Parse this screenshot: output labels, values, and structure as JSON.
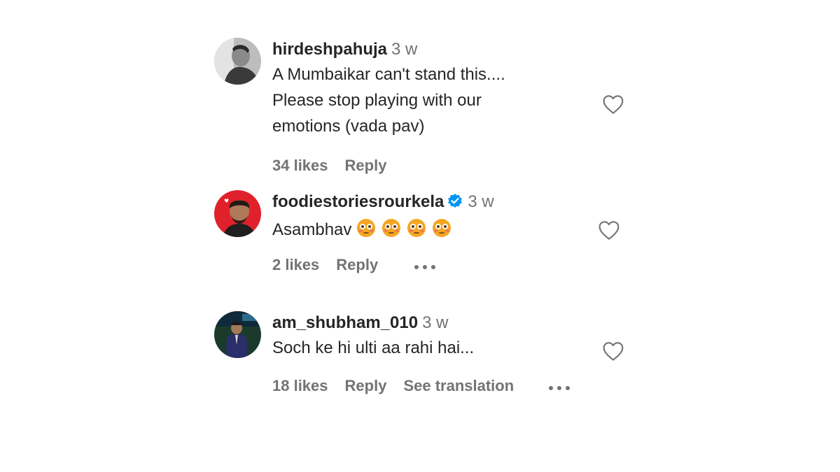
{
  "comments": [
    {
      "username": "hirdeshpahuja",
      "time": "3 w",
      "text_lines": [
        "A Mumbaikar can't stand this....",
        "Please stop playing with our",
        "emotions (vada pav)"
      ],
      "likes": "34 likes",
      "reply": "Reply",
      "verified": false,
      "icons": {
        "avatar": "profile-photo",
        "like": "heart-outline-icon"
      }
    },
    {
      "username": "foodiestoriesrourkela",
      "time": "3 w",
      "text": "Asambhav",
      "emojis": [
        "flushed-face",
        "flushed-face",
        "flushed-face",
        "flushed-face"
      ],
      "likes": "2 likes",
      "reply": "Reply",
      "verified": true,
      "icons": {
        "avatar": "profile-photo",
        "verified": "verified-badge-icon",
        "like": "heart-outline-icon",
        "more": "more-options-icon"
      }
    },
    {
      "username": "am_shubham_010",
      "time": "3 w",
      "text": "Soch ke hi ulti aa rahi hai...",
      "likes": "18 likes",
      "reply": "Reply",
      "see_translation": "See translation",
      "verified": false,
      "icons": {
        "avatar": "profile-photo",
        "like": "heart-outline-icon",
        "more": "more-options-icon"
      }
    }
  ],
  "colors": {
    "text": "#262626",
    "secondary": "#737373",
    "verified": "#0095f6",
    "emoji": "#f5a623"
  }
}
